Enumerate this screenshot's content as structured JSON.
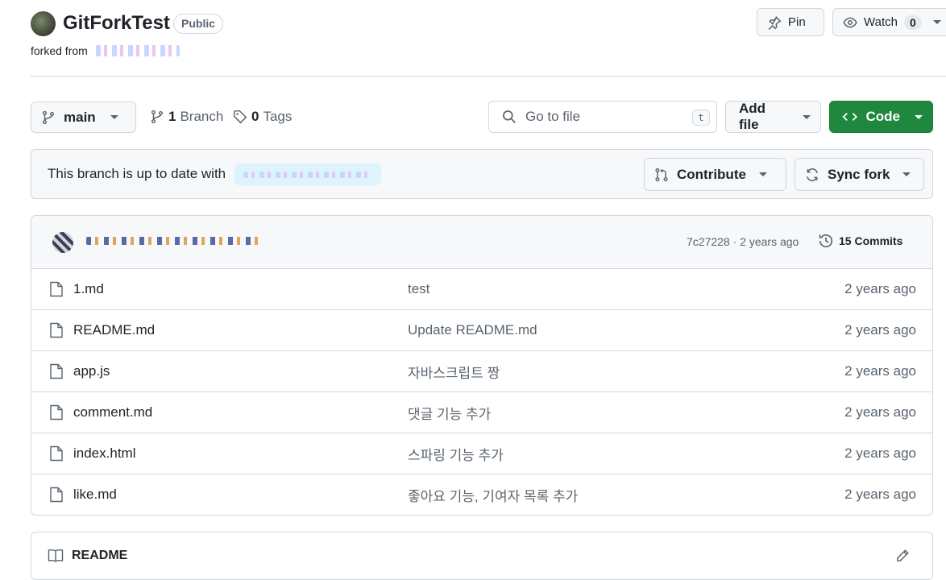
{
  "repo": {
    "name": "GitForkTest",
    "visibility": "Public",
    "forked_from_label": "forked from"
  },
  "header_actions": {
    "pin_label": "Pin",
    "watch_label": "Watch",
    "watch_count": "0"
  },
  "toolbar": {
    "branch": "main",
    "branch_count": "1",
    "branch_label": "Branch",
    "tag_count": "0",
    "tag_label": "Tags",
    "search_placeholder": "Go to file",
    "search_shortcut": "t",
    "add_file_label": "Add file",
    "code_label": "Code"
  },
  "fork_status": {
    "text": "This branch is up to date with",
    "contribute_label": "Contribute",
    "sync_label": "Sync fork"
  },
  "latest_commit": {
    "hash": "7c27228",
    "time": "2 years ago",
    "hash_time": "7c27228 · 2 years ago",
    "commits_count_label": "15 Commits"
  },
  "files": [
    {
      "name": "1.md",
      "message": "test",
      "date": "2 years ago"
    },
    {
      "name": "README.md",
      "message": "Update README.md",
      "date": "2 years ago"
    },
    {
      "name": "app.js",
      "message": "자바스크립트 짱",
      "date": "2 years ago"
    },
    {
      "name": "comment.md",
      "message": "댓글 기능 추가",
      "date": "2 years ago"
    },
    {
      "name": "index.html",
      "message": "스파링 기능 추가",
      "date": "2 years ago"
    },
    {
      "name": "like.md",
      "message": "좋아요 기능, 기여자 목록 추가",
      "date": "2 years ago"
    }
  ],
  "readme": {
    "title": "README"
  },
  "colors": {
    "accent_green": "#1f883d",
    "border": "#d0d7de",
    "muted_text": "#59636e"
  }
}
